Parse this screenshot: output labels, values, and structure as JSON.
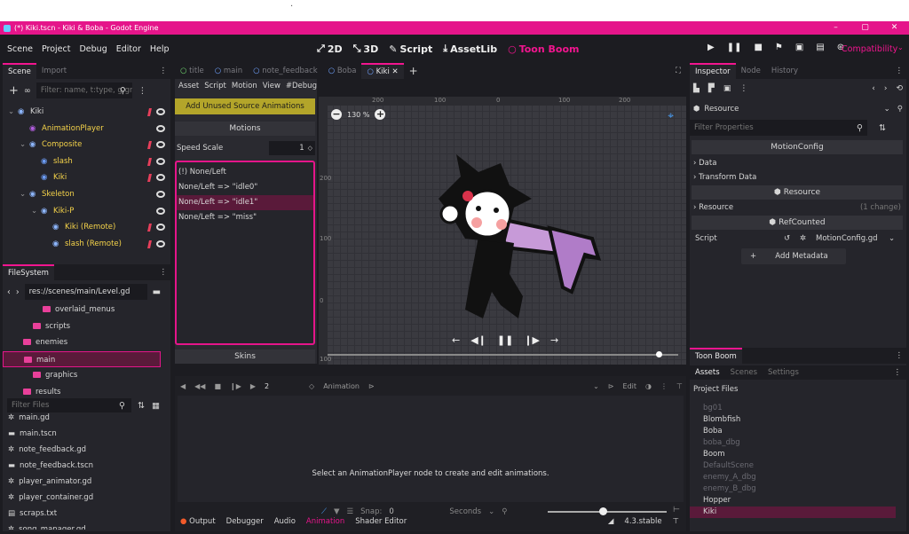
{
  "window": {
    "title": "(*) Kiki.tscn - Kiki & Boba - Godot Engine",
    "minimize": "–",
    "maximize": "▢",
    "close": "✕"
  },
  "menu": {
    "items": [
      "Scene",
      "Project",
      "Debug",
      "Editor",
      "Help"
    ]
  },
  "workspaces": {
    "w2d": "2D",
    "w3d": "3D",
    "script": "Script",
    "assetlib": "AssetLib",
    "toonboom": "Toon Boom"
  },
  "renderer": "Compatibility",
  "scene_dock": {
    "tabs": [
      "Scene",
      "Import"
    ],
    "filter_placeholder": "Filter: name, t:type, g:gro",
    "nodes": [
      {
        "label": "Kiki",
        "indent": 0,
        "color": "white"
      },
      {
        "label": "AnimationPlayer",
        "indent": 1,
        "color": "yellow"
      },
      {
        "label": "Composite",
        "indent": 1,
        "color": "yellow"
      },
      {
        "label": "slash",
        "indent": 2,
        "color": "yellow"
      },
      {
        "label": "Kiki",
        "indent": 2,
        "color": "yellow"
      },
      {
        "label": "Skeleton",
        "indent": 1,
        "color": "yellow"
      },
      {
        "label": "Kiki-P",
        "indent": 2,
        "color": "yellow"
      },
      {
        "label": "Kiki (Remote)",
        "indent": 3,
        "color": "yellow"
      },
      {
        "label": "slash (Remote)",
        "indent": 3,
        "color": "yellow"
      }
    ]
  },
  "filesystem": {
    "title": "FileSystem",
    "path": "res://scenes/main/Level.gd",
    "folders": [
      "overlaid_menus",
      "scripts",
      "enemies",
      "main",
      "graphics",
      "results"
    ],
    "filter_placeholder": "Filter Files",
    "files": [
      "main.gd",
      "main.tscn",
      "note_feedback.gd",
      "note_feedback.tscn",
      "player_animator.gd",
      "player_container.gd",
      "scraps.txt",
      "song_manager.gd"
    ]
  },
  "editor_tabs": [
    "title",
    "main",
    "note_feedback",
    "Boba",
    "Kiki"
  ],
  "toonboom_panel": {
    "menu": [
      "Asset",
      "Script",
      "Motion",
      "View",
      "#Debug"
    ],
    "add_button": "Add Unused Source Animations",
    "motions_label": "Motions",
    "speed_label": "Speed Scale",
    "speed_value": "1",
    "motions": [
      "(!) None/Left",
      "None/Left => \"idle0\"",
      "None/Left => \"idle1\"",
      "None/Left => \"miss\""
    ],
    "selected_index": 2,
    "skins_label": "Skins"
  },
  "viewport": {
    "zoom": "130 %",
    "ruler": [
      "200",
      "100",
      "0",
      "100",
      "200"
    ],
    "vruler": [
      "200",
      "100",
      "0",
      "100"
    ]
  },
  "animation_panel": {
    "frame": "2",
    "animation_label": "Animation",
    "edit_label": "Edit",
    "message": "Select an AnimationPlayer node to create and edit animations.",
    "snap_label": "Snap:",
    "snap_value": "0",
    "seconds_label": "Seconds"
  },
  "bottom_bar": {
    "items": [
      "Output",
      "Debugger",
      "Audio",
      "Animation",
      "Shader Editor"
    ],
    "version": "4.3.stable"
  },
  "inspector": {
    "tabs": [
      "Inspector",
      "Node",
      "History"
    ],
    "resource_label": "Resource",
    "filter_placeholder": "Filter Properties",
    "class_name": "MotionConfig",
    "sections": [
      "Data",
      "Transform Data"
    ],
    "resource_header": "Resource",
    "resource_section": "Resource",
    "resource_changes": "(1 change)",
    "refcounted": "RefCounted",
    "script_label": "Script",
    "script_value": "MotionConfig.gd",
    "add_metadata": "Add Metadata"
  },
  "toonboom_dock": {
    "title": "Toon Boom",
    "tabs": [
      "Assets",
      "Scenes",
      "Settings"
    ],
    "project_files": "Project Files",
    "assets": [
      {
        "name": "bg01",
        "dim": true
      },
      {
        "name": "Blombfish",
        "dim": false
      },
      {
        "name": "Boba",
        "dim": false
      },
      {
        "name": "boba_dbg",
        "dim": true
      },
      {
        "name": "Boom",
        "dim": false
      },
      {
        "name": "DefaultScene",
        "dim": true
      },
      {
        "name": "enemy_A_dbg",
        "dim": true
      },
      {
        "name": "enemy_B_dbg",
        "dim": true
      },
      {
        "name": "Hopper",
        "dim": false
      },
      {
        "name": "Kiki",
        "dim": false
      }
    ],
    "selected": "Kiki"
  },
  "colors": {
    "accent": "#f2158f",
    "titlebar": "#e5158a",
    "node_yellow": "#f5d34a"
  }
}
